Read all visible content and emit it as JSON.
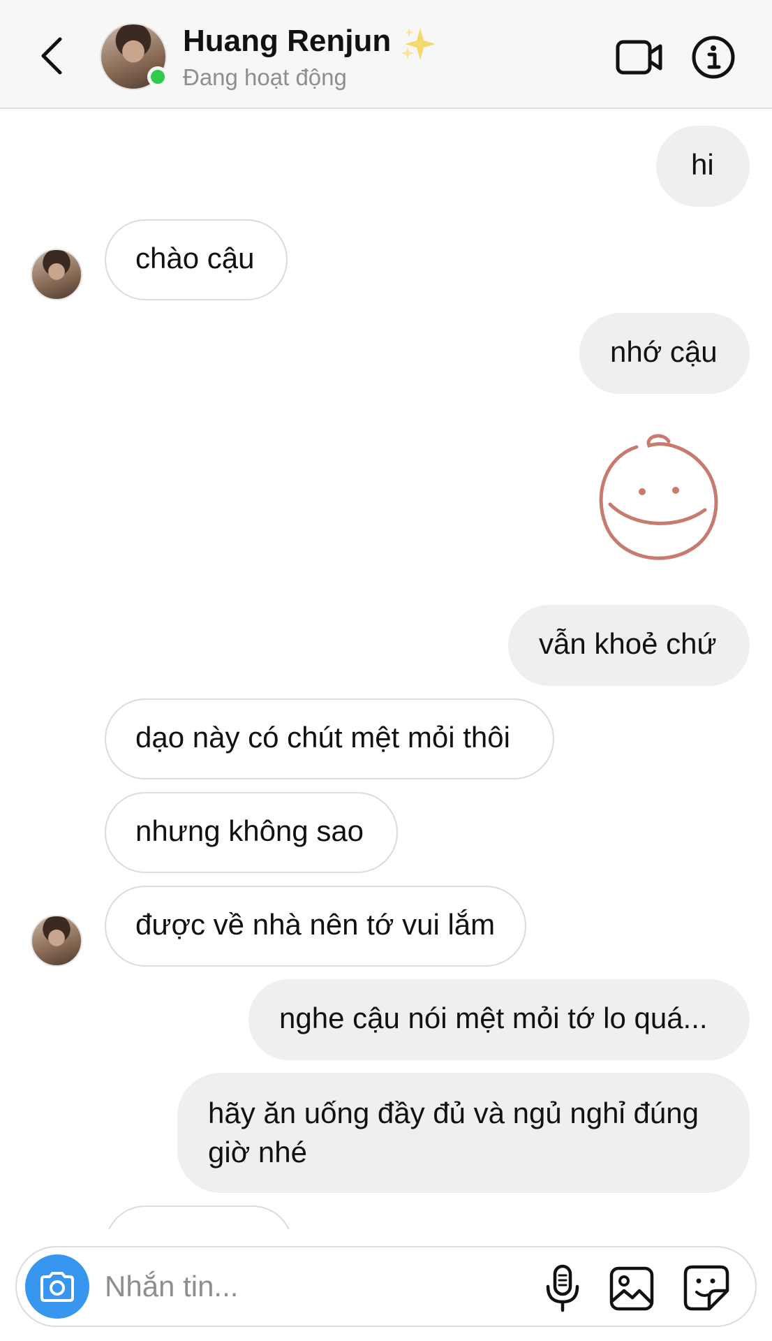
{
  "header": {
    "contact_name": "Huang Renjun",
    "name_emoji": "sparkles-icon",
    "status": "Đang hoạt động",
    "status_color": "#2fcb4a",
    "actions": [
      "video-call-icon",
      "info-icon"
    ]
  },
  "messages": [
    {
      "direction": "outgoing",
      "text": "hi"
    },
    {
      "direction": "incoming",
      "text": "chào cậu"
    },
    {
      "direction": "outgoing",
      "text": "nhớ cậu"
    },
    {
      "direction": "outgoing",
      "type": "sticker",
      "sticker": "smiley-face-sticker",
      "color": "#c77b6f"
    },
    {
      "direction": "outgoing",
      "text": "vẫn khoẻ chứ"
    },
    {
      "direction": "incoming",
      "text": "dạo này có chút mệt mỏi thôi"
    },
    {
      "direction": "incoming",
      "text": "nhưng không sao"
    },
    {
      "direction": "incoming",
      "text": "được về nhà nên tớ vui lắm"
    },
    {
      "direction": "outgoing",
      "text": "nghe cậu nói mệt mỏi tớ lo quá..."
    },
    {
      "direction": "outgoing",
      "text_line1": "hãy ăn uống đầy đủ và ngủ nghỉ đúng",
      "text_line2": "giờ nhé"
    }
  ],
  "composer": {
    "placeholder": "Nhắn tin...",
    "camera_color": "#3797f0",
    "icons": [
      "camera-icon",
      "microphone-icon",
      "gallery-icon",
      "sticker-icon"
    ]
  },
  "colors": {
    "outgoing_bubble": "#efefef",
    "incoming_border": "#dbdbdb",
    "header_bg": "#f7f7f7"
  }
}
